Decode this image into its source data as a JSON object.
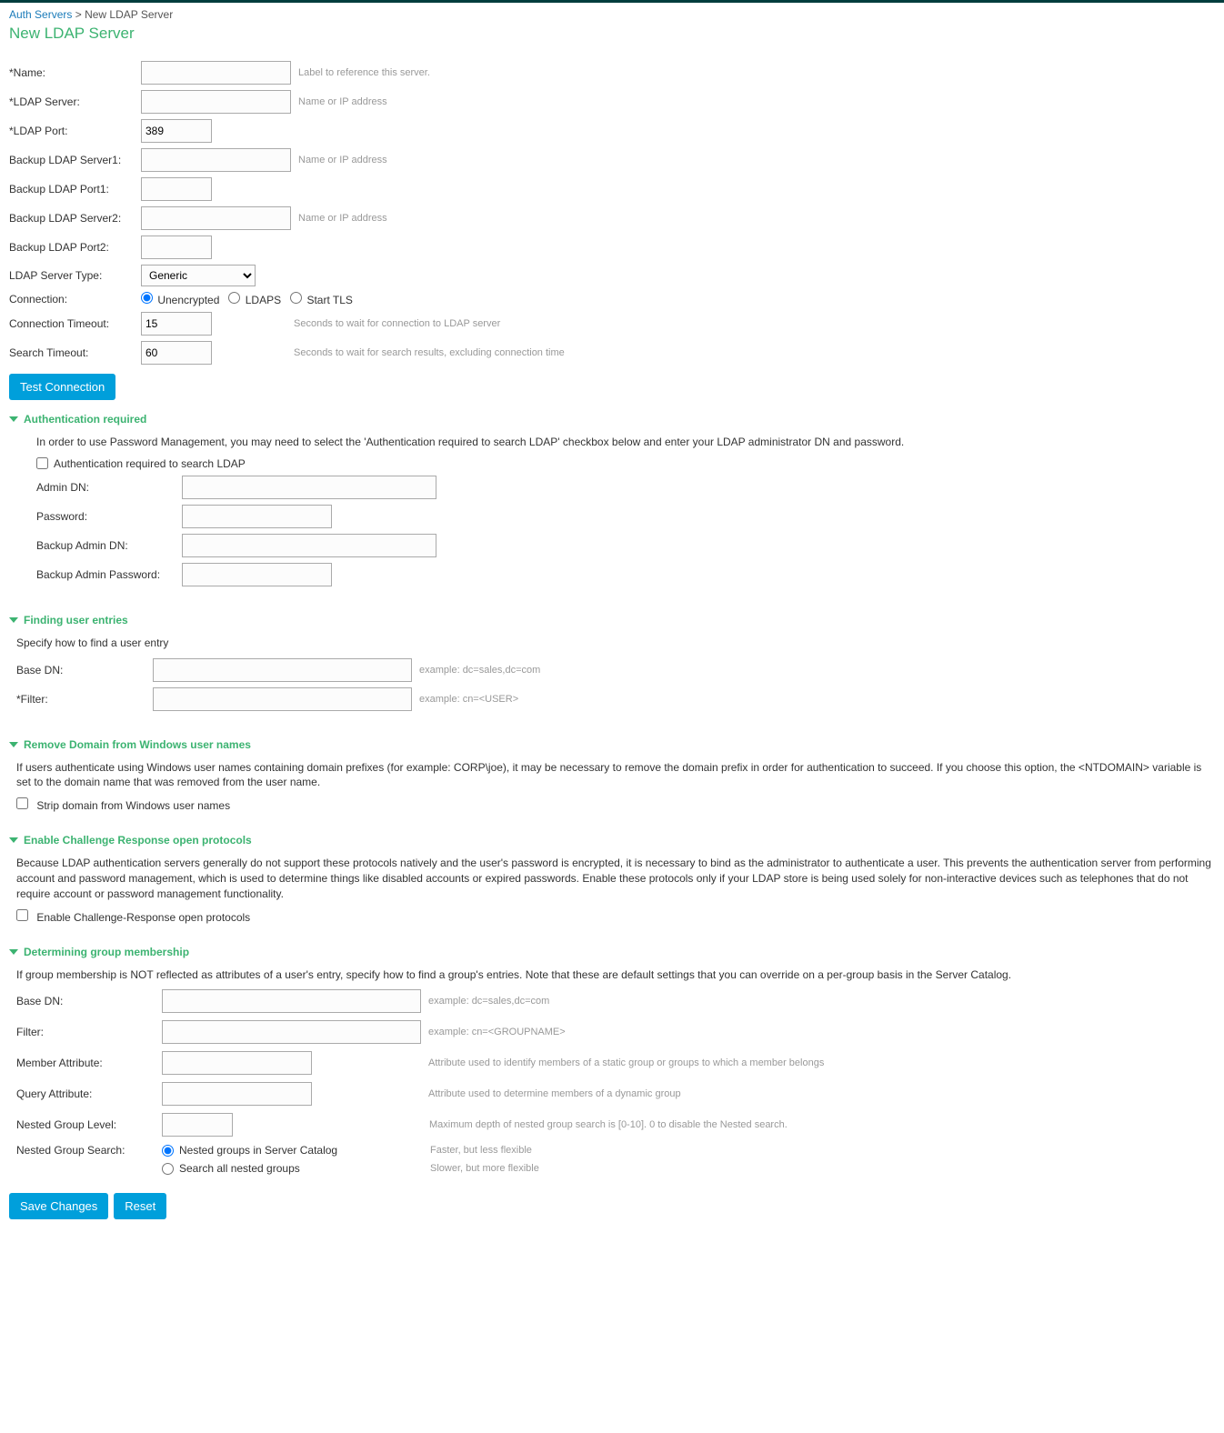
{
  "breadcrumb": {
    "link": "Auth Servers",
    "sep": " > ",
    "current": "New LDAP Server"
  },
  "title": "New LDAP Server",
  "form": {
    "name": {
      "label": "*Name:",
      "value": "",
      "hint": "Label to reference this server."
    },
    "ldap_server": {
      "label": "*LDAP Server:",
      "value": "",
      "hint": "Name or IP address"
    },
    "ldap_port": {
      "label": "*LDAP Port:",
      "value": "389"
    },
    "backup1_server": {
      "label": "Backup LDAP Server1:",
      "value": "",
      "hint": "Name or IP address"
    },
    "backup1_port": {
      "label": "Backup LDAP Port1:",
      "value": ""
    },
    "backup2_server": {
      "label": "Backup LDAP Server2:",
      "value": "",
      "hint": "Name or IP address"
    },
    "backup2_port": {
      "label": "Backup LDAP Port2:",
      "value": ""
    },
    "server_type": {
      "label": "LDAP Server Type:",
      "selected": "Generic",
      "options": [
        "Generic"
      ]
    },
    "connection": {
      "label": "Connection:",
      "opt1": "Unencrypted",
      "opt2": "LDAPS",
      "opt3": "Start TLS"
    },
    "conn_timeout": {
      "label": "Connection Timeout:",
      "value": "15",
      "hint": "Seconds to wait for connection to LDAP server"
    },
    "search_timeout": {
      "label": "Search Timeout:",
      "value": "60",
      "hint": "Seconds to wait for search results, excluding connection time"
    }
  },
  "test_btn": "Test Connection",
  "auth_req": {
    "header": "Authentication required",
    "para": "In order to use Password Management, you may need to select the 'Authentication required to search LDAP' checkbox below and enter your LDAP administrator DN and password.",
    "checkbox": "Authentication required to search LDAP",
    "admin_dn": {
      "label": "Admin DN:"
    },
    "password": {
      "label": "Password:"
    },
    "backup_admin_dn": {
      "label": "Backup Admin DN:"
    },
    "backup_admin_pw": {
      "label": "Backup Admin Password:"
    }
  },
  "finding": {
    "header": "Finding user entries",
    "para": "Specify how to find a user entry",
    "base_dn": {
      "label": "Base DN:",
      "hint": "example: dc=sales,dc=com"
    },
    "filter": {
      "label": "*Filter:",
      "hint": "example: cn=<USER>"
    }
  },
  "remove_domain": {
    "header": "Remove Domain from Windows user names",
    "para": "If users authenticate using Windows user names containing domain prefixes (for example: CORP\\joe), it may be necessary to remove the domain prefix in order for authentication to succeed. If you choose this option, the <NTDOMAIN> variable is set to the domain name that was removed from the user name.",
    "checkbox": "Strip domain from Windows user names"
  },
  "challenge": {
    "header": "Enable Challenge Response open protocols",
    "para": "Because LDAP authentication servers generally do not support these protocols natively and the user's password is encrypted, it is necessary to bind as the administrator to authenticate a user. This prevents the authentication server from performing account and password management, which is used to determine things like disabled accounts or expired passwords. Enable these protocols only if your LDAP store is being used solely for non-interactive devices such as telephones that do not require account or password management functionality.",
    "checkbox": "Enable Challenge-Response open protocols"
  },
  "group": {
    "header": "Determining group membership",
    "para": "If group membership is NOT reflected as attributes of a user's entry, specify how to find a group's entries. Note that these are default settings that you can override on a per-group basis in the Server Catalog.",
    "base_dn": {
      "label": "Base DN:",
      "hint": "example: dc=sales,dc=com"
    },
    "filter": {
      "label": "Filter:",
      "hint": "example: cn=<GROUPNAME>"
    },
    "member_attr": {
      "label": "Member Attribute:",
      "hint": "Attribute used to identify members of a static group or groups to which a member belongs"
    },
    "query_attr": {
      "label": "Query Attribute:",
      "hint": "Attribute used to determine members of a dynamic group"
    },
    "nested_level": {
      "label": "Nested Group Level:",
      "hint": "Maximum depth of nested group search is [0-10]. 0 to disable the Nested search."
    },
    "nested_search": {
      "label": "Nested Group Search:",
      "opt1": "Nested groups in Server Catalog",
      "hint1": "Faster, but less flexible",
      "opt2": "Search all nested groups",
      "hint2": "Slower, but more flexible"
    }
  },
  "footer": {
    "save": "Save Changes",
    "reset": "Reset"
  }
}
